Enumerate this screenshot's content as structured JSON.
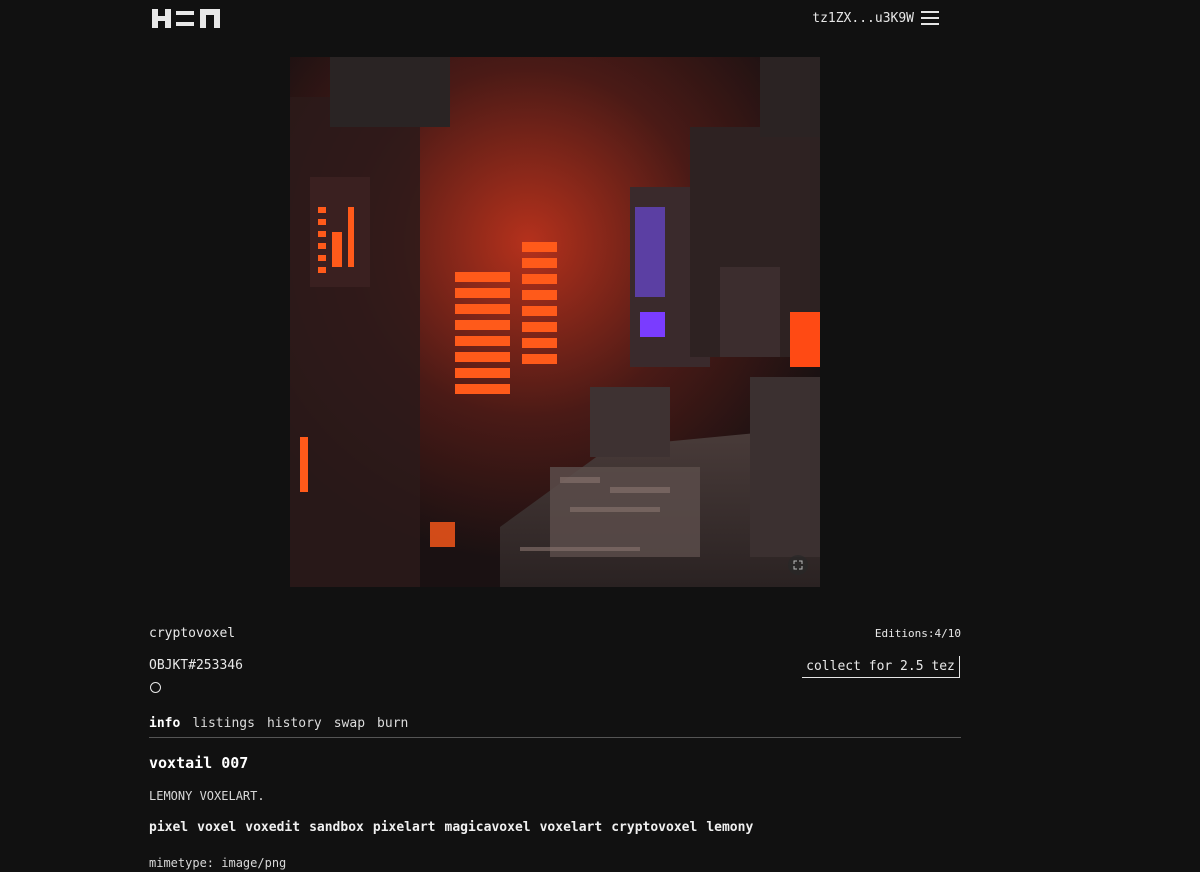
{
  "header": {
    "logo": "H=N",
    "wallet": "tz1ZX...u3K9W"
  },
  "artwork": {
    "icon": "fullscreen-icon"
  },
  "object": {
    "creator": "cryptovoxel",
    "editions": "Editions:4/10",
    "id": "OBJKT#253346",
    "collect_label": "collect for 2.5 tez"
  },
  "tabs": [
    {
      "label": "info"
    },
    {
      "label": "listings"
    },
    {
      "label": "history"
    },
    {
      "label": "swap"
    },
    {
      "label": "burn"
    }
  ],
  "info": {
    "title": "voxtail 007",
    "description": "LEMONY VOXELART.",
    "tags": [
      "pixel",
      "voxel",
      "voxedit",
      "sandbox",
      "pixelart",
      "magicavoxel",
      "voxelart",
      "cryptovoxel",
      "lemony"
    ],
    "mimetype": "mimetype: image/png"
  },
  "colors": {
    "background": "#111111",
    "accent_orange": "#ff5a1a",
    "accent_purple": "#7a3cff"
  }
}
